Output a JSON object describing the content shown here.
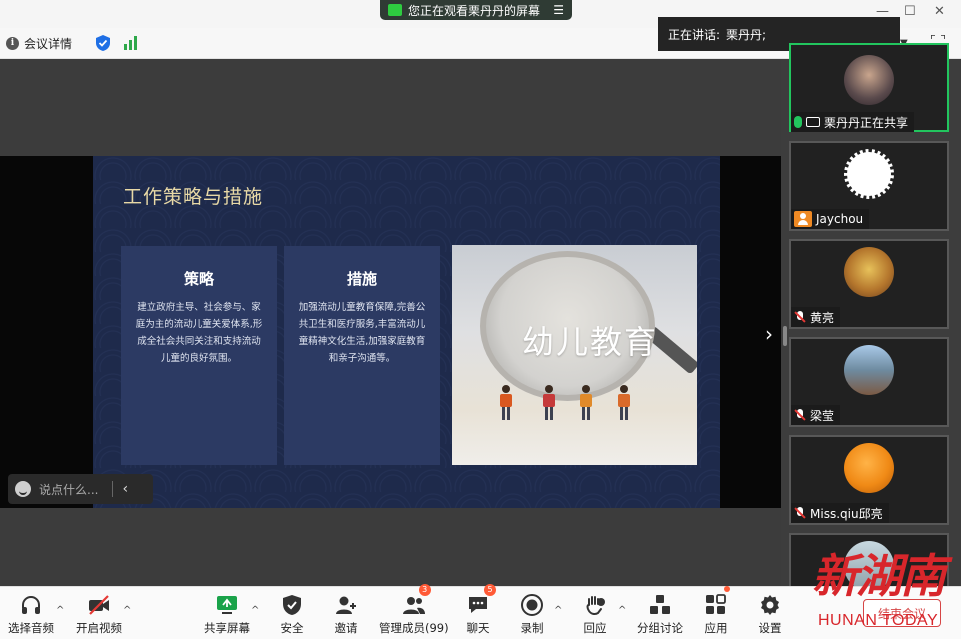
{
  "topbar": {
    "info_label": "会议详情",
    "info_icon_glyph": "i"
  },
  "window": {
    "minimize": "—",
    "maximize": "☐",
    "close": "✕"
  },
  "banner": {
    "text": "您正在观看栗丹丹的屏幕",
    "menu_glyph": "☰"
  },
  "speaker": {
    "label": "正在讲话:",
    "name": "栗丹丹;"
  },
  "slide": {
    "title": "工作策略与措施",
    "cards": [
      {
        "heading": "策略",
        "body": "建立政府主导、社会参与、家庭为主的流动儿童关爱体系,形成全社会共同关注和支持流动儿童的良好氛围。"
      },
      {
        "heading": "措施",
        "body": "加强流动儿童教育保障,完善公共卫生和医疗服务,丰富流动儿童精神文化生活,加强家庭教育和亲子沟通等。"
      }
    ],
    "photo_text": "幼儿教育"
  },
  "chat": {
    "placeholder": "说点什么...",
    "collapse_glyph": "‹"
  },
  "next_glyph": "›",
  "participants": [
    {
      "name": "栗丹丹正在共享",
      "status": "mic-on",
      "sharing": true,
      "active": true
    },
    {
      "name": "Jaychou",
      "status": "user",
      "active": false
    },
    {
      "name": "黄亮",
      "status": "mic-off",
      "active": false
    },
    {
      "name": "梁莹",
      "status": "mic-off",
      "active": false
    },
    {
      "name": "Miss.qiu邱亮",
      "status": "mic-off",
      "active": false
    },
    {
      "name": "",
      "status": "none",
      "active": false
    }
  ],
  "toolbar": {
    "audio": "选择音频",
    "video": "开启视频",
    "share": "共享屏幕",
    "security": "安全",
    "invite": "邀请",
    "members": "管理成员(99)",
    "members_badge": "3",
    "chat": "聊天",
    "chat_badge": "5",
    "record": "录制",
    "react": "回应",
    "breakout": "分组讨论",
    "apps": "应用",
    "settings": "设置",
    "end": "结束会议",
    "caret_glyph": "^"
  },
  "watermark": {
    "script": "新湖南",
    "en": "HUNAN TODAY"
  },
  "colors": {
    "accent_green": "#22c55e",
    "end_red": "#d64545",
    "badge": "#ff5a36",
    "slide_bg": "#1e2a4b",
    "title_gold": "#e8d9a6"
  }
}
